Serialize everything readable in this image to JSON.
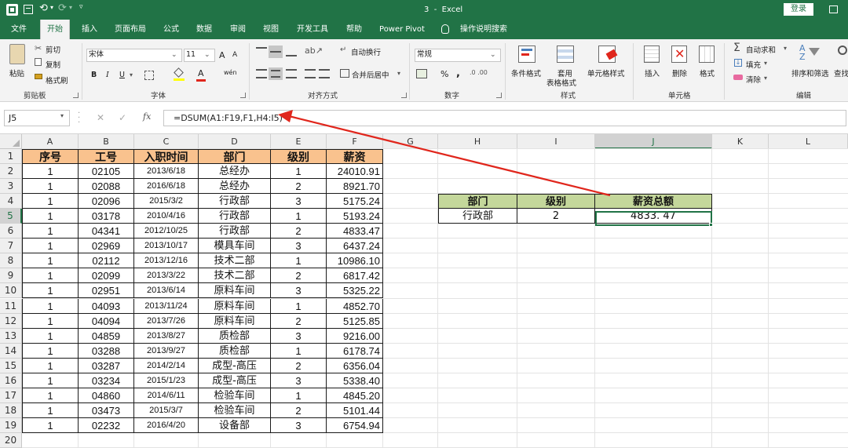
{
  "window": {
    "title": "3  -  Excel",
    "login": "登录"
  },
  "tabs": [
    "文件",
    "开始",
    "插入",
    "页面布局",
    "公式",
    "数据",
    "审阅",
    "视图",
    "开发工具",
    "帮助",
    "Power Pivot"
  ],
  "tell_me": "操作说明搜索",
  "ribbon": {
    "clipboard": {
      "paste": "粘贴",
      "cut": "剪切",
      "copy": "复制",
      "format_painter": "格式刷",
      "group": "剪贴板"
    },
    "font": {
      "name": "宋体",
      "size": "11",
      "group": "字体",
      "bold": "B",
      "italic": "I",
      "underline": "U",
      "font_color_letter": "A",
      "grow": "A",
      "shrink": "A",
      "wen": "wén"
    },
    "alignment": {
      "wrap_text": "自动换行",
      "merge_center": "合并后居中",
      "group": "对齐方式"
    },
    "number": {
      "format": "常规",
      "percent": "%",
      "comma": ",",
      "group": "数字"
    },
    "styles": {
      "conditional": "条件格式",
      "table_format_1": "套用",
      "table_format_2": "表格格式",
      "cell_styles": "单元格样式",
      "group": "样式"
    },
    "cells": {
      "insert": "插入",
      "delete": "删除",
      "format": "格式",
      "group": "单元格"
    },
    "editing": {
      "autosum": "自动求和",
      "fill": "填充",
      "clear": "清除",
      "sort_filter": "排序和筛选",
      "find": "查找",
      "group": "编辑"
    }
  },
  "formula_bar": {
    "name_box": "J5",
    "fx": "fx",
    "formula": "=DSUM(A1:F19,F1,H4:I5)"
  },
  "columns": [
    "A",
    "B",
    "C",
    "D",
    "E",
    "F",
    "G",
    "H",
    "I",
    "J",
    "K",
    "L"
  ],
  "rows": [
    "1",
    "2",
    "3",
    "4",
    "5",
    "6",
    "7",
    "8",
    "9",
    "10",
    "11",
    "12",
    "13",
    "14",
    "15",
    "16",
    "17",
    "18",
    "19",
    "20"
  ],
  "table": {
    "headers": [
      "序号",
      "工号",
      "入职时间",
      "部门",
      "级别",
      "薪资"
    ],
    "rows": [
      [
        "1",
        "02105",
        "2013/6/18",
        "总经办",
        "1",
        "24010.91"
      ],
      [
        "1",
        "02088",
        "2016/6/18",
        "总经办",
        "2",
        "8921.70"
      ],
      [
        "1",
        "02096",
        "2015/3/2",
        "行政部",
        "3",
        "5175.24"
      ],
      [
        "1",
        "03178",
        "2010/4/16",
        "行政部",
        "1",
        "5193.24"
      ],
      [
        "1",
        "04341",
        "2012/10/25",
        "行政部",
        "2",
        "4833.47"
      ],
      [
        "1",
        "02969",
        "2013/10/17",
        "模具车间",
        "3",
        "6437.24"
      ],
      [
        "1",
        "02112",
        "2013/12/16",
        "技术二部",
        "1",
        "10986.10"
      ],
      [
        "1",
        "02099",
        "2013/3/22",
        "技术二部",
        "2",
        "6817.42"
      ],
      [
        "1",
        "02951",
        "2013/6/14",
        "原料车间",
        "3",
        "5325.22"
      ],
      [
        "1",
        "04093",
        "2013/11/24",
        "原料车间",
        "1",
        "4852.70"
      ],
      [
        "1",
        "04094",
        "2013/7/26",
        "原料车间",
        "2",
        "5125.85"
      ],
      [
        "1",
        "04859",
        "2013/8/27",
        "质检部",
        "3",
        "9216.00"
      ],
      [
        "1",
        "03288",
        "2013/9/27",
        "质检部",
        "1",
        "6178.74"
      ],
      [
        "1",
        "03287",
        "2014/2/14",
        "成型-高压",
        "2",
        "6356.04"
      ],
      [
        "1",
        "03234",
        "2015/1/23",
        "成型-高压",
        "3",
        "5338.40"
      ],
      [
        "1",
        "04860",
        "2014/6/11",
        "检验车间",
        "1",
        "4845.20"
      ],
      [
        "1",
        "03473",
        "2015/3/7",
        "检验车间",
        "2",
        "5101.44"
      ],
      [
        "1",
        "02232",
        "2016/4/20",
        "设备部",
        "3",
        "6754.94"
      ]
    ]
  },
  "criteria": {
    "headers": [
      "部门",
      "级别",
      "薪资总额"
    ],
    "values": [
      "行政部",
      "2",
      "4833. 47"
    ]
  },
  "colors": {
    "brand": "#217346",
    "header_fill": "#f9c28e",
    "criteria_fill": "#c4d79b",
    "arrow": "#e0261c"
  }
}
